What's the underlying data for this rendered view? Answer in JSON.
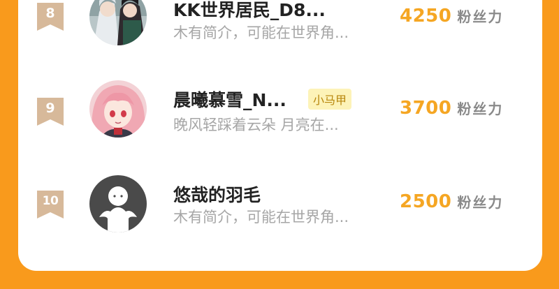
{
  "rows": [
    {
      "rank": "8",
      "name": "KK世界居民_D8...",
      "bio": "木有简介，可能在世界角...",
      "badge": "",
      "fans_count": "4250",
      "fans_unit": "粉丝力"
    },
    {
      "rank": "9",
      "name": "晨曦慕雪_N...",
      "bio": "晚风轻踩着云朵 月亮在...",
      "badge": "小马甲",
      "fans_count": "3700",
      "fans_unit": "粉丝力"
    },
    {
      "rank": "10",
      "name": "悠哉的羽毛",
      "bio": "木有简介，可能在世界角...",
      "badge": "",
      "fans_count": "2500",
      "fans_unit": "粉丝力"
    }
  ],
  "colors": {
    "page_background": "#f99a1c",
    "rank_ribbon": "#d7b99a",
    "fans_count": "#f5a623",
    "badge_background": "#fdf3b8",
    "badge_text": "#b8860b"
  }
}
